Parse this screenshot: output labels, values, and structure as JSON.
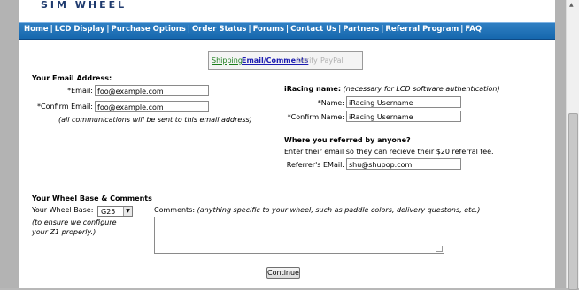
{
  "logo": "SIM WHEEL",
  "nav": [
    "Home",
    "LCD Display",
    "Purchase Options",
    "Order Status",
    "Forums",
    "Contact Us",
    "Partners",
    "Referral Program",
    "FAQ"
  ],
  "steps": {
    "shipping": "Shipping",
    "email": "Email/Comments",
    "verify": "Verify",
    "paypal": "PayPal"
  },
  "email_section": {
    "title": "Your Email Address:",
    "email_label": "*Email:",
    "email_value": "foo@example.com",
    "confirm_label": "*Confirm Email:",
    "confirm_value": "foo@example.com",
    "note": "(all communications will be sent to this email address)"
  },
  "iracing": {
    "title": "iRacing name:",
    "title_note": "(necessary for LCD software authentication)",
    "name_label": "*Name:",
    "name_value": "iRacing Username",
    "confirm_label": "*Confirm Name:",
    "confirm_value": "iRacing Username"
  },
  "referral": {
    "title": "Where you referred by anyone?",
    "desc": "Enter their email so they can recieve their $20 referral fee.",
    "label": "Referrer's EMail:",
    "value": "shu@shupop.com"
  },
  "wheel": {
    "title": "Your Wheel Base & Comments",
    "base_label": "Your Wheel Base:",
    "base_value": "G25",
    "note1": "(to ensure we configure",
    "note2": "your Z1 properly.)",
    "comments_label": "Comments:",
    "comments_note": "(anything specific to your wheel, such as paddle colors, delivery questons, etc.)",
    "comments_value": ""
  },
  "continue_label": "Continue"
}
